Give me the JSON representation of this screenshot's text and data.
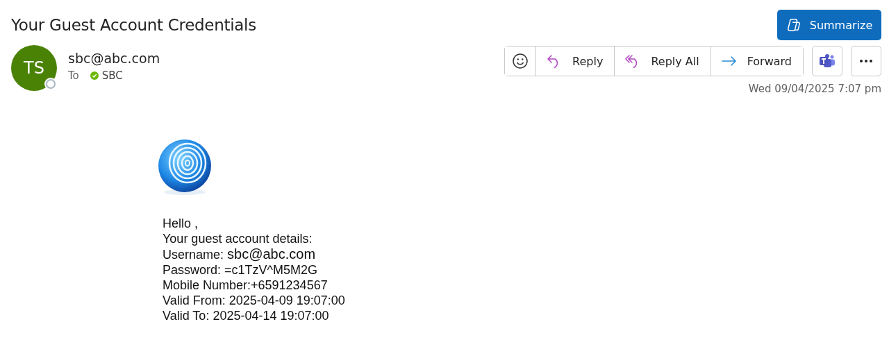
{
  "subject": "Your Guest Account Credentials",
  "sender": {
    "initials": "TS",
    "color": "#498205",
    "address": "sbc@abc.com",
    "to_label": "To",
    "recipient": "SBC"
  },
  "actions": {
    "summarize": "Summarize",
    "reply": "Reply",
    "reply_all": "Reply All",
    "forward": "Forward"
  },
  "date": "Wed 09/04/2025 7:07 pm",
  "body": {
    "lines": [
      {
        "text": "Hello ,"
      },
      {
        "text": "Your guest account details:"
      },
      {
        "label": "Username:",
        "value": "sbc@abc.com"
      },
      {
        "text": "Password: =c1TzV^M5M2G"
      },
      {
        "text": "Mobile Number:+6591234567"
      },
      {
        "text": "Valid From: 2025-04-09 19:07:00"
      },
      {
        "text": "Valid To: 2025-04-14 19:07:00"
      }
    ]
  }
}
